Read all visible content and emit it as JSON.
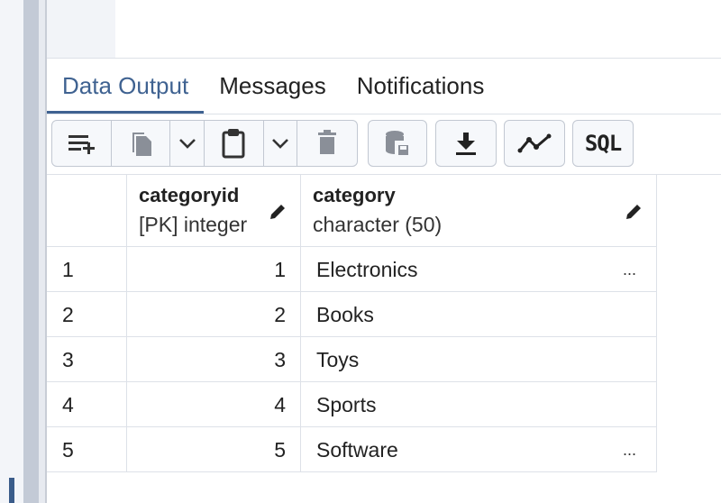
{
  "tabs": [
    {
      "label": "Data Output",
      "active": true
    },
    {
      "label": "Messages",
      "active": false
    },
    {
      "label": "Notifications",
      "active": false
    }
  ],
  "toolbar": {
    "buttons": [
      "add-row-icon",
      "copy-icon",
      "chevron-down-icon",
      "paste-icon",
      "chevron-down-icon",
      "delete-icon",
      "save-data-icon",
      "download-icon",
      "graph-icon",
      "sql-icon"
    ],
    "sql_label": "SQL"
  },
  "grid": {
    "columns": [
      {
        "name": "categoryid",
        "type": "[PK] integer"
      },
      {
        "name": "category",
        "type": "character (50)"
      }
    ],
    "rows": [
      {
        "rownum": "1",
        "categoryid": "1",
        "category": "Electronics",
        "truncated": true
      },
      {
        "rownum": "2",
        "categoryid": "2",
        "category": "Books",
        "truncated": false
      },
      {
        "rownum": "3",
        "categoryid": "3",
        "category": "Toys",
        "truncated": false
      },
      {
        "rownum": "4",
        "categoryid": "4",
        "category": "Sports",
        "truncated": false
      },
      {
        "rownum": "5",
        "categoryid": "5",
        "category": "Software",
        "truncated": true
      }
    ],
    "ellipsis": "..."
  },
  "colors": {
    "accent": "#3f6291",
    "icon": "#333333"
  }
}
